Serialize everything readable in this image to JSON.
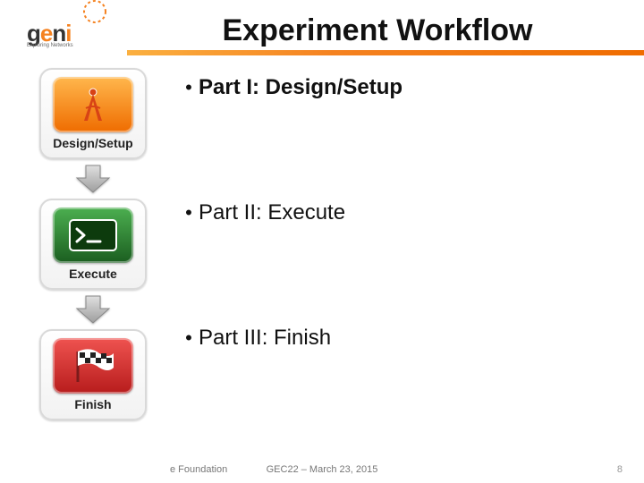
{
  "header": {
    "logo": {
      "text": "geni",
      "subtitle": "Exploring Networks"
    },
    "title": "Experiment Workflow"
  },
  "workflow": [
    {
      "label": "Design/Setup",
      "icon": "compass-icon",
      "color": "orange"
    },
    {
      "label": "Execute",
      "icon": "terminal-icon",
      "color": "green"
    },
    {
      "label": "Finish",
      "icon": "flag-icon",
      "color": "red"
    }
  ],
  "bullets": [
    {
      "text": "Part I: Design/Setup",
      "bold": true
    },
    {
      "text": "Part II: Execute",
      "bold": false
    },
    {
      "text": "Part III: Finish",
      "bold": false
    }
  ],
  "footer": {
    "left_fragment": "e Foundation",
    "center": "GEC22 – March 23, 2015",
    "page_number": "8"
  }
}
